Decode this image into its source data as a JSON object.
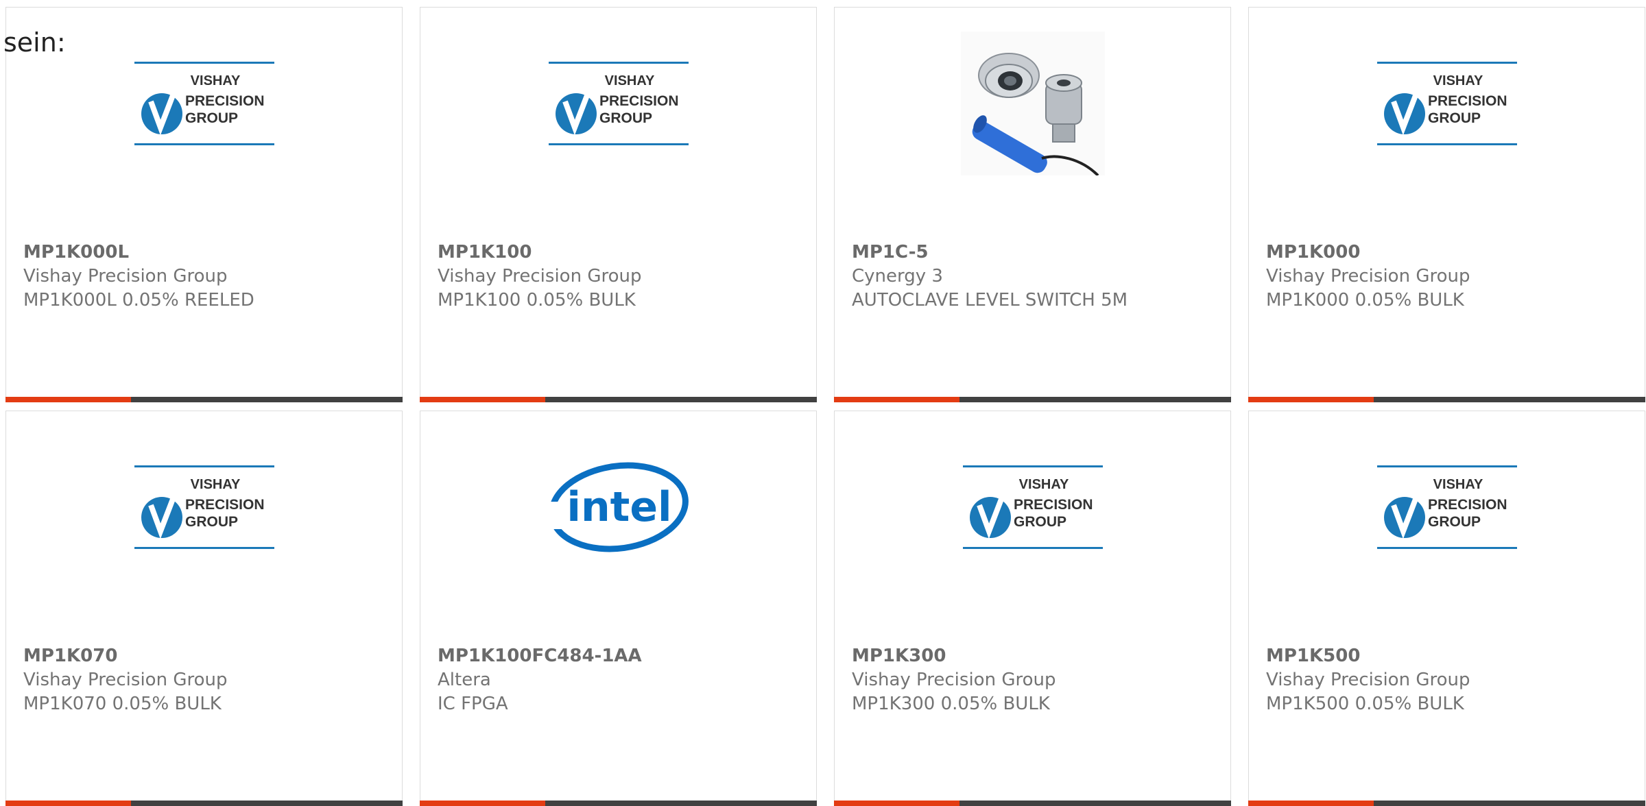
{
  "intro_text": "sein:",
  "colors": {
    "accent": "#e33c13",
    "bar": "#414141",
    "vishay_blue": "#1b79b8",
    "intel_blue": "#0a6fc2"
  },
  "logos": {
    "vishay": {
      "line1": "VISHAY",
      "line2": "PRECISION",
      "line3": "GROUP"
    },
    "intel": {
      "text": "intel"
    }
  },
  "products": [
    {
      "part": "MP1K000L",
      "maker": "Vishay Precision Group",
      "desc": "MP1K000L 0.05% REELED",
      "image": "vishay-logo"
    },
    {
      "part": "MP1K100",
      "maker": "Vishay Precision Group",
      "desc": "MP1K100 0.05% BULK",
      "image": "vishay-logo"
    },
    {
      "part": "MP1C-5",
      "maker": "Cynergy 3",
      "desc": "AUTOCLAVE LEVEL SWITCH 5M",
      "image": "level-switch-photo"
    },
    {
      "part": "MP1K000",
      "maker": "Vishay Precision Group",
      "desc": "MP1K000 0.05% BULK",
      "image": "vishay-logo"
    },
    {
      "part": "MP1K070",
      "maker": "Vishay Precision Group",
      "desc": "MP1K070 0.05% BULK",
      "image": "vishay-logo"
    },
    {
      "part": "MP1K100FC484-1AA",
      "maker": "Altera",
      "desc": "IC FPGA",
      "image": "intel-logo"
    },
    {
      "part": "MP1K300",
      "maker": "Vishay Precision Group",
      "desc": "MP1K300 0.05% BULK",
      "image": "vishay-logo"
    },
    {
      "part": "MP1K500",
      "maker": "Vishay Precision Group",
      "desc": "MP1K500 0.05% BULK",
      "image": "vishay-logo"
    }
  ]
}
